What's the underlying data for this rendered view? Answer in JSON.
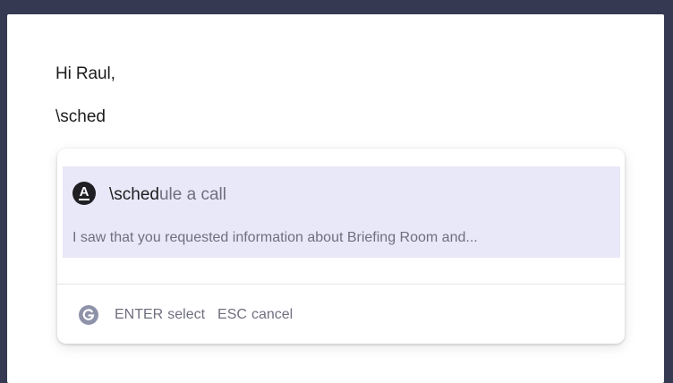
{
  "editor": {
    "greeting": "Hi Raul,",
    "typed_text": "\\sched"
  },
  "popup": {
    "suggestion": {
      "badge_letter": "A",
      "title_match": "\\sched",
      "title_rest": "ule a call",
      "description": "I saw that you requested information about Briefing Room and..."
    },
    "footer": {
      "icon": "grammarly-g-icon",
      "enter_key": "ENTER",
      "enter_action": "select",
      "esc_key": "ESC",
      "esc_action": "cancel"
    }
  },
  "colors": {
    "backdrop": "#353a52",
    "highlight": "#e8e8f8",
    "muted_text": "#6f6f80",
    "badge": "#1f1f24"
  }
}
